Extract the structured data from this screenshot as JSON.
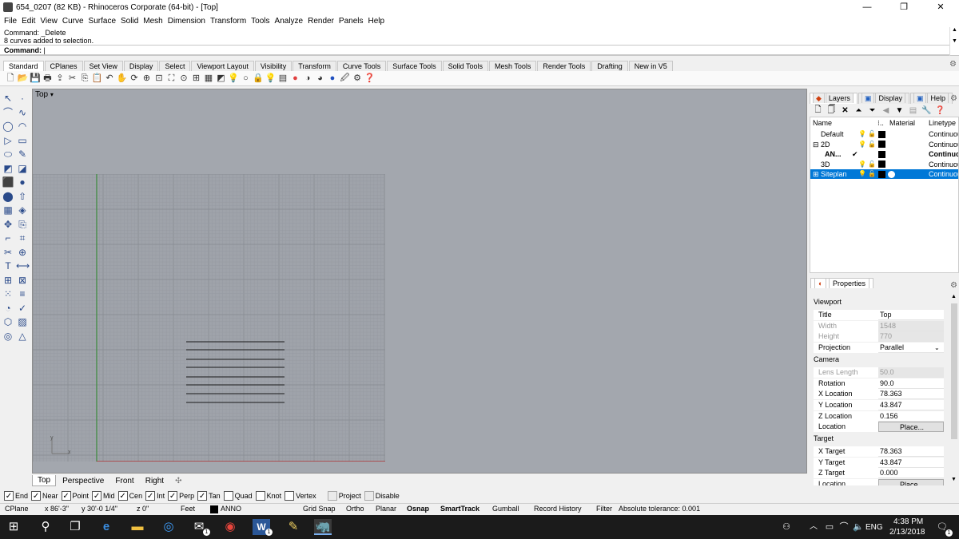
{
  "titlebar": {
    "title": "654_0207 (82 KB) - Rhinoceros Corporate (64-bit) - [Top]",
    "minimize": "—",
    "maximize": "❐",
    "close": "✕"
  },
  "menu": [
    "File",
    "Edit",
    "View",
    "Curve",
    "Surface",
    "Solid",
    "Mesh",
    "Dimension",
    "Transform",
    "Tools",
    "Analyze",
    "Render",
    "Panels",
    "Help"
  ],
  "command": {
    "history": [
      "Command: _Delete",
      "8 curves added to selection."
    ],
    "prompt": "Command:"
  },
  "toolbar_tabs": [
    "Standard",
    "CPlanes",
    "Set View",
    "Display",
    "Select",
    "Viewport Layout",
    "Visibility",
    "Transform",
    "Curve Tools",
    "Surface Tools",
    "Solid Tools",
    "Mesh Tools",
    "Render Tools",
    "Drafting",
    "New in V5"
  ],
  "toolbar_icons": [
    "new-file-icon",
    "open-file-icon",
    "save-icon",
    "print-icon",
    "import-icon",
    "cut-icon",
    "copy-icon",
    "paste-icon",
    "undo-icon",
    "pan-icon",
    "rotate-view-icon",
    "zoom-in-icon",
    "zoom-window-icon",
    "zoom-extents-icon",
    "zoom-selected-icon",
    "four-viewports-icon",
    "grid-icon",
    "cplane-icon",
    "show-objects-icon",
    "hide-objects-icon",
    "lock-icon",
    "light-icon",
    "layer-icon",
    "color-wheel-icon",
    "shade-icon",
    "render-icon",
    "sphere-icon",
    "properties-icon",
    "options-icon",
    "help-icon"
  ],
  "viewport": {
    "title": "Top",
    "dropdown": "▾",
    "axis_x": "x",
    "axis_y": "y"
  },
  "viewport_tabs": [
    "Top",
    "Perspective",
    "Front",
    "Right"
  ],
  "viewport_tab_add": "✣",
  "osnaps": [
    {
      "label": "End",
      "checked": true
    },
    {
      "label": "Near",
      "checked": true
    },
    {
      "label": "Point",
      "checked": true
    },
    {
      "label": "Mid",
      "checked": true
    },
    {
      "label": "Cen",
      "checked": true
    },
    {
      "label": "Int",
      "checked": true
    },
    {
      "label": "Perp",
      "checked": true
    },
    {
      "label": "Tan",
      "checked": true
    },
    {
      "label": "Quad",
      "checked": false
    },
    {
      "label": "Knot",
      "checked": false
    },
    {
      "label": "Vertex",
      "checked": false
    },
    {
      "label": "Project",
      "checked": false,
      "disabled": true
    },
    {
      "label": "Disable",
      "checked": false,
      "disabled": true
    }
  ],
  "check_mark": "✓",
  "status": {
    "cplane": "CPlane",
    "x": "x 86'-3\"",
    "y": "y 30'-0 1/4\"",
    "z": "z 0\"",
    "units": "Feet",
    "layer": "ANNO",
    "grid_snap": "Grid Snap",
    "ortho": "Ortho",
    "planar": "Planar",
    "osnap": "Osnap",
    "smarttrack": "SmartTrack",
    "gumball": "Gumball",
    "record_history": "Record History",
    "filter": "Filter",
    "tolerance": "Absolute tolerance: 0.001"
  },
  "layers_panel": {
    "tabs": [
      "Layers",
      "Display",
      "Help"
    ],
    "headers": {
      "name": "Name",
      "col": "⁝..",
      "material": "Material",
      "linetype": "Linetype"
    },
    "rows": [
      {
        "name": "Default",
        "expander": "",
        "current": "",
        "bulb": "💡",
        "lock": "🔓",
        "linetype": "Continuous",
        "bold": false,
        "selected": false
      },
      {
        "name": "2D",
        "expander": "⊟",
        "current": "",
        "bulb": "💡",
        "lock": "🔓",
        "linetype": "Continuous",
        "bold": false,
        "selected": false
      },
      {
        "name": "AN...",
        "expander": "",
        "current": "✔",
        "bulb": "",
        "lock": "",
        "linetype": "Continuous",
        "bold": true,
        "selected": false
      },
      {
        "name": "3D",
        "expander": "",
        "current": "",
        "bulb": "💡",
        "lock": "🔓",
        "linetype": "Continuous",
        "bold": false,
        "selected": false
      },
      {
        "name": "Siteplan",
        "expander": "⊞",
        "current": "",
        "bulb": "💡",
        "lock": "🔓",
        "linetype": "Continuous",
        "bold": false,
        "selected": true
      }
    ]
  },
  "properties_panel": {
    "tab": "Properties",
    "sections": {
      "viewport": "Viewport",
      "camera": "Camera",
      "target": "Target"
    },
    "viewport_rows": [
      {
        "label": "Title",
        "value": "Top",
        "readonly": false
      },
      {
        "label": "Width",
        "value": "1548",
        "readonly": true
      },
      {
        "label": "Height",
        "value": "770",
        "readonly": true
      },
      {
        "label": "Projection",
        "value": "Parallel",
        "readonly": false,
        "dropdown": true
      }
    ],
    "camera_rows": [
      {
        "label": "Lens Length",
        "value": "50.0",
        "readonly": true
      },
      {
        "label": "Rotation",
        "value": "90.0",
        "readonly": false
      },
      {
        "label": "X Location",
        "value": "78.363",
        "readonly": false
      },
      {
        "label": "Y Location",
        "value": "43.847",
        "readonly": false
      },
      {
        "label": "Z Location",
        "value": "0.156",
        "readonly": false
      },
      {
        "label": "Location",
        "value": "Place...",
        "button": true
      }
    ],
    "target_rows": [
      {
        "label": "X Target",
        "value": "78.363",
        "readonly": false
      },
      {
        "label": "Y Target",
        "value": "43.847",
        "readonly": false
      },
      {
        "label": "Z Target",
        "value": "0.000",
        "readonly": false
      },
      {
        "label": "Location",
        "value": "Place...",
        "button": true
      }
    ]
  },
  "taskbar": {
    "time": "4:38 PM",
    "date": "2/13/2018",
    "lang": "ENG",
    "badge": "1"
  }
}
